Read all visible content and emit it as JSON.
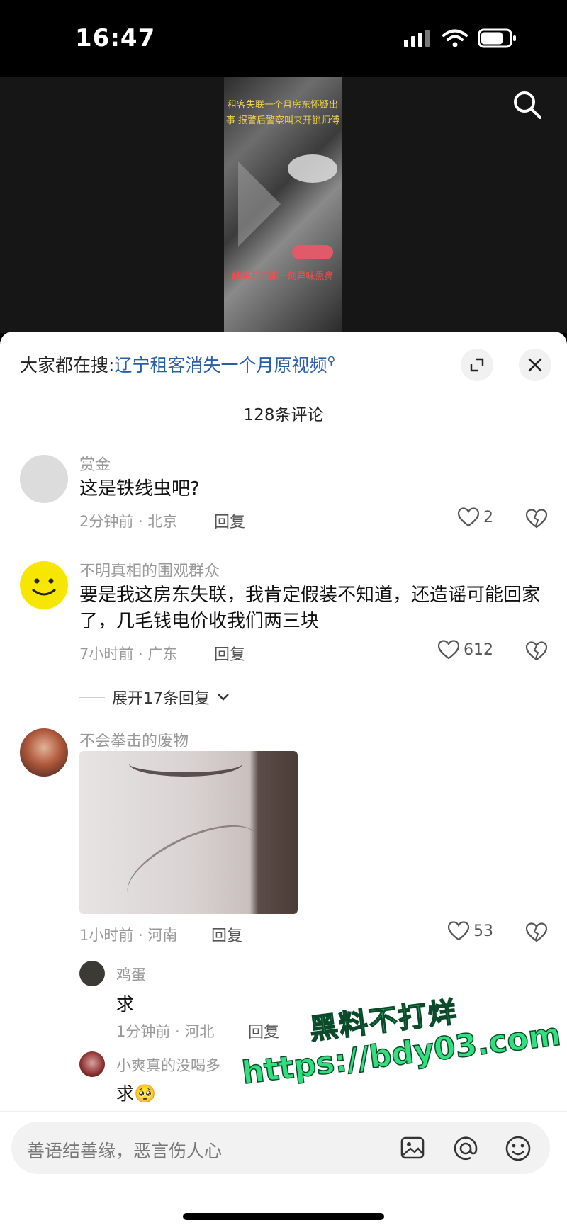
{
  "status_bar": {
    "time": "16:47"
  },
  "video": {
    "overlay_top": "租客失联一个月房东怀疑出事 报警后警察叫来开锁师傅",
    "overlay_bottom": "结果开门那一刻异味熏鼻"
  },
  "sheet": {
    "hot_prefix": "大家都在搜:",
    "hot_query": "辽宁租客消失一个月原视频",
    "comment_count": "128条评论"
  },
  "comments": [
    {
      "user": "赏金",
      "text": "这是铁线虫吧?",
      "time_loc": "2分钟前 · 北京",
      "reply": "回复",
      "likes": "2"
    },
    {
      "user": "不明真相的围观群众",
      "text": "要是我这房东失联，我肯定假装不知道，还造谣可能回家了，几毛钱电价收我们两三块",
      "time_loc": "7小时前 · 广东",
      "reply": "回复",
      "likes": "612",
      "expand": "展开17条回复"
    },
    {
      "user": "不会拳击的废物",
      "time_loc": "1小时前 · 河南",
      "reply": "回复",
      "likes": "53"
    }
  ],
  "subreplies": [
    {
      "user": "鸡蛋",
      "text": "求",
      "time_loc": "1分钟前 · 河北",
      "reply": "回复"
    },
    {
      "user": "小爽真的没喝多",
      "text": "求🥺"
    }
  ],
  "watermark": {
    "line1": "黑料不打烊",
    "line2": "https://bdy03.com"
  },
  "input": {
    "placeholder": "善语结善缘，恶言伤人心"
  }
}
